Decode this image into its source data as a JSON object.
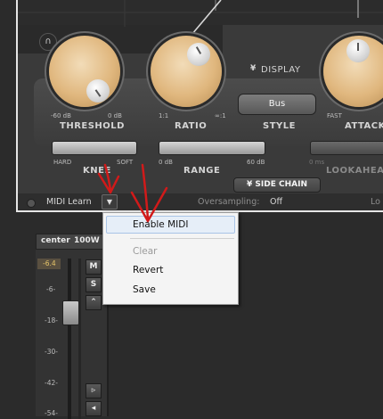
{
  "plugin": {
    "display_label": "DISPLAY",
    "side_chain_label": "SIDE CHAIN",
    "knobs": {
      "threshold": {
        "label": "THRESHOLD",
        "min": "-60 dB",
        "max": "0 dB"
      },
      "ratio": {
        "label": "RATIO",
        "min": "1:1",
        "max": "∞:1"
      },
      "attack": {
        "label": "ATTACK",
        "min": "FAST"
      }
    },
    "style": {
      "label": "STYLE",
      "value": "Bus"
    },
    "sliders": {
      "knee": {
        "label": "KNEE",
        "min": "HARD",
        "max": "SOFT"
      },
      "range": {
        "label": "RANGE",
        "min": "0 dB",
        "max": "60 dB"
      },
      "lookahead": {
        "label": "LOOKAHEAD",
        "min": "0 ms"
      }
    },
    "bottom_bar": {
      "midi_learn": "MIDI Learn",
      "oversampling_label": "Oversampling:",
      "oversampling_value": "Off",
      "right_text": "Lo"
    },
    "colors": {
      "knob": "#e0b77e",
      "panel": "#3a3a3a",
      "annotation": "#d11a1a"
    }
  },
  "context_menu": {
    "items": [
      {
        "label": "Enable MIDI",
        "enabled": true,
        "highlighted": true
      },
      {
        "label": "Clear",
        "enabled": false
      },
      {
        "label": "Revert",
        "enabled": true
      },
      {
        "label": "Save",
        "enabled": true
      }
    ]
  },
  "mixer": {
    "channel_name": "center",
    "channel_power": "100W",
    "peak_value": "-6.4",
    "scale": [
      "-6-",
      "-18-",
      "-30-",
      "-42-",
      "-54-"
    ],
    "mute_label": "M",
    "solo_label": "S"
  }
}
